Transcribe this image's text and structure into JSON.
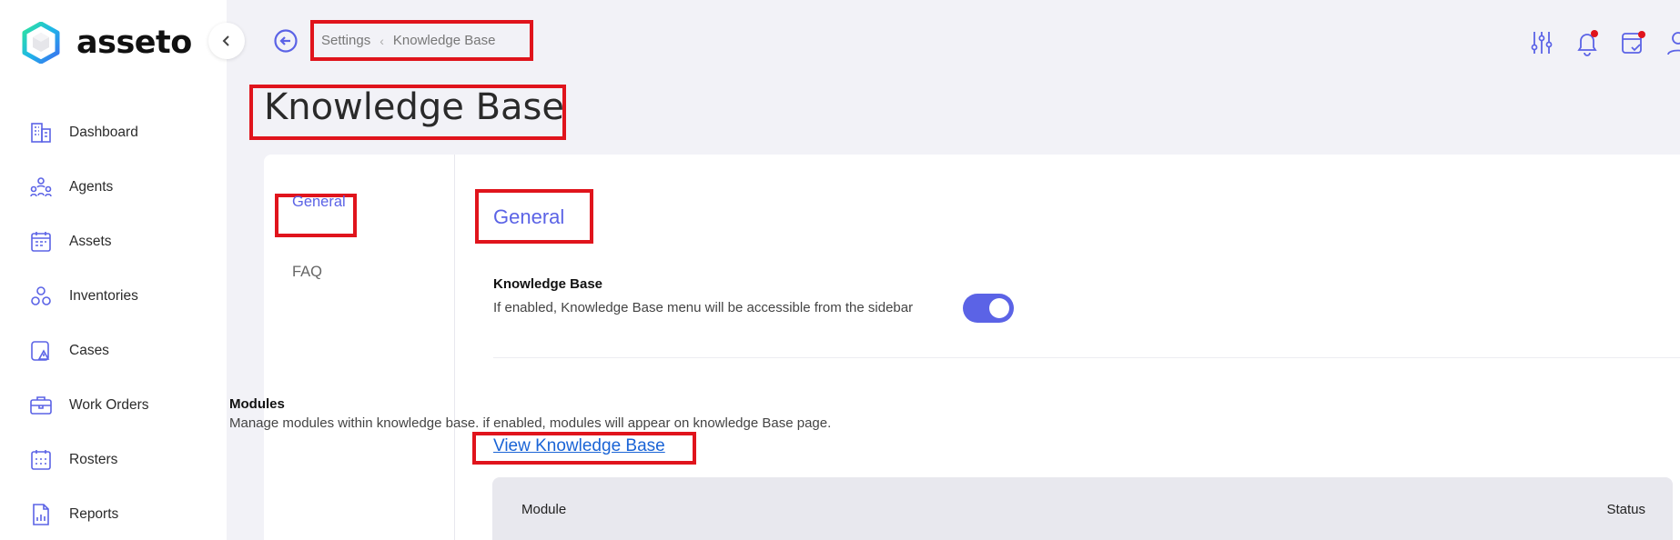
{
  "app": {
    "name": "asseto"
  },
  "sidebar": {
    "items": [
      {
        "label": "Dashboard",
        "icon": "building-icon"
      },
      {
        "label": "Agents",
        "icon": "users-icon"
      },
      {
        "label": "Assets",
        "icon": "assets-icon"
      },
      {
        "label": "Inventories",
        "icon": "inventory-icon"
      },
      {
        "label": "Cases",
        "icon": "cases-icon"
      },
      {
        "label": "Work Orders",
        "icon": "work-orders-icon"
      },
      {
        "label": "Rosters",
        "icon": "calendar-icon"
      },
      {
        "label": "Reports",
        "icon": "reports-icon"
      }
    ]
  },
  "header": {
    "breadcrumb": {
      "parent": "Settings",
      "current": "Knowledge Base"
    },
    "title": "Knowledge Base"
  },
  "tabs": [
    {
      "label": "General",
      "active": true
    },
    {
      "label": "FAQ",
      "active": false
    }
  ],
  "general": {
    "title": "General",
    "knowledge_base": {
      "label": "Knowledge Base",
      "description": "If enabled, Knowledge Base menu will be accessible from the sidebar",
      "enabled": true
    },
    "modules": {
      "label": "Modules",
      "description": "Manage modules within knowledge base. if enabled, modules will appear on knowledge Base page.",
      "link_text": "View Knowledge Base"
    },
    "table": {
      "col_module": "Module",
      "col_status": "Status"
    }
  },
  "colors": {
    "accent": "#5b63e6",
    "highlight": "#e0141c",
    "link": "#1a64d6"
  }
}
